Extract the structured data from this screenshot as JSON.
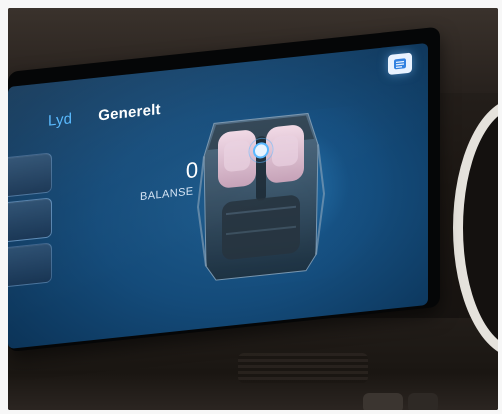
{
  "tabs": [
    {
      "label": "Lyd",
      "active": true
    },
    {
      "label": "Generelt",
      "active": false
    }
  ],
  "balance": {
    "value": "0",
    "label": "BALANSE"
  },
  "icons": {
    "note": "note-icon",
    "seat_layout": "car-seat-layout-icon"
  },
  "colors": {
    "accent": "#51b7ff",
    "screen_background": "#0c355a",
    "text_primary": "#ffffff"
  }
}
